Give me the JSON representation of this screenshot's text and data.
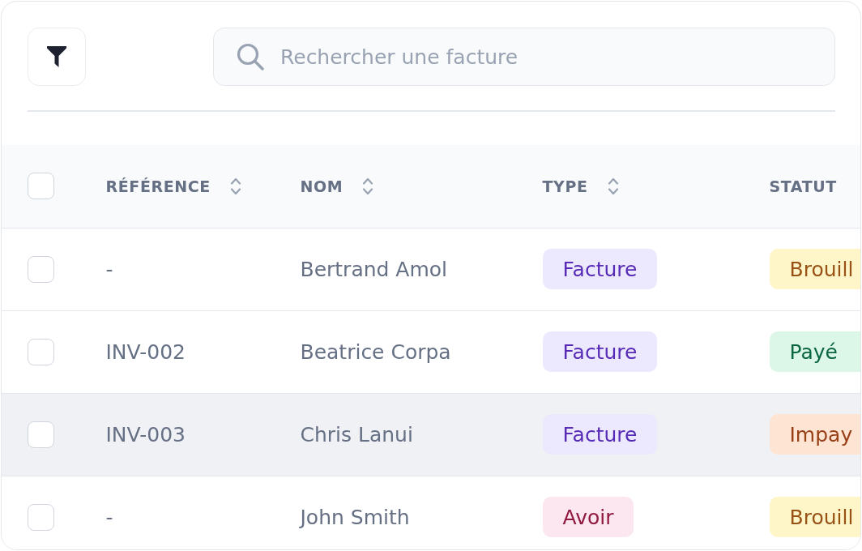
{
  "toolbar": {
    "search": {
      "placeholder": "Rechercher une facture"
    }
  },
  "table": {
    "select_all": {
      "checked": false
    },
    "columns": [
      {
        "label": "RÉFÉRENCE",
        "sortable": true
      },
      {
        "label": "NOM",
        "sortable": true
      },
      {
        "label": "TYPE",
        "sortable": true
      },
      {
        "label": "STATUT",
        "sortable": false
      }
    ],
    "rows": [
      {
        "checked": false,
        "hovered": false,
        "reference": "-",
        "name": "Bertrand Amol",
        "type": {
          "label": "Facture",
          "color": "#ece9fe"
        },
        "status": {
          "label": "Brouill",
          "color": "#fef6c8"
        }
      },
      {
        "checked": false,
        "hovered": false,
        "reference": "INV-002",
        "name": "Beatrice Corpa",
        "type": {
          "label": "Facture",
          "color": "#ece9fe"
        },
        "status": {
          "label": "Payé",
          "color": "#dcf7e8"
        }
      },
      {
        "checked": false,
        "hovered": true,
        "reference": "INV-003",
        "name": "Chris Lanui",
        "type": {
          "label": "Facture",
          "color": "#ece9fe"
        },
        "status": {
          "label": "Impay",
          "color": "#fde4d3"
        }
      },
      {
        "checked": false,
        "hovered": false,
        "reference": "-",
        "name": "John Smith",
        "type": {
          "label": "Avoir",
          "color": "#fce7f1"
        },
        "status": {
          "label": "Brouill",
          "color": "#fef6c8"
        }
      }
    ]
  }
}
